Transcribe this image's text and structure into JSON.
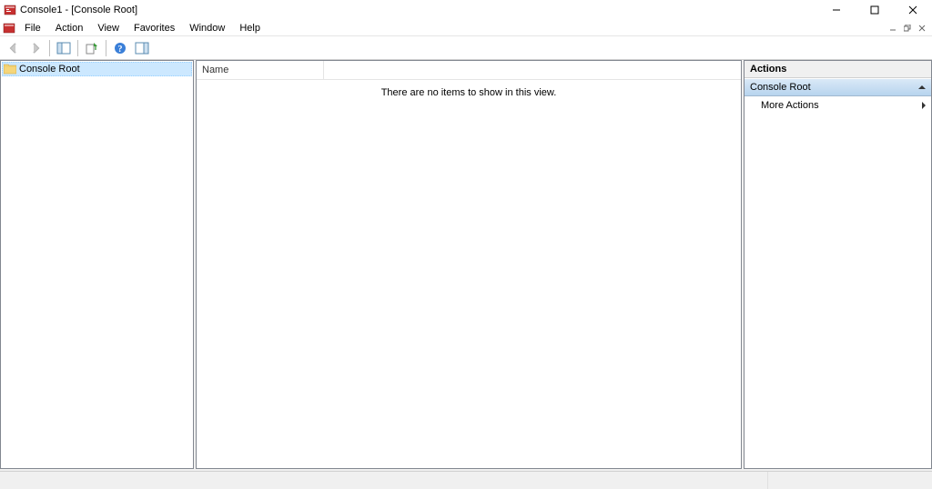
{
  "window": {
    "title": "Console1 - [Console Root]"
  },
  "menu": {
    "file": "File",
    "action": "Action",
    "view": "View",
    "favorites": "Favorites",
    "window": "Window",
    "help": "Help"
  },
  "tree": {
    "root_label": "Console Root"
  },
  "list": {
    "col_name": "Name",
    "empty_text": "There are no items to show in this view."
  },
  "actions": {
    "header": "Actions",
    "group_label": "Console Root",
    "more_actions": "More Actions"
  }
}
